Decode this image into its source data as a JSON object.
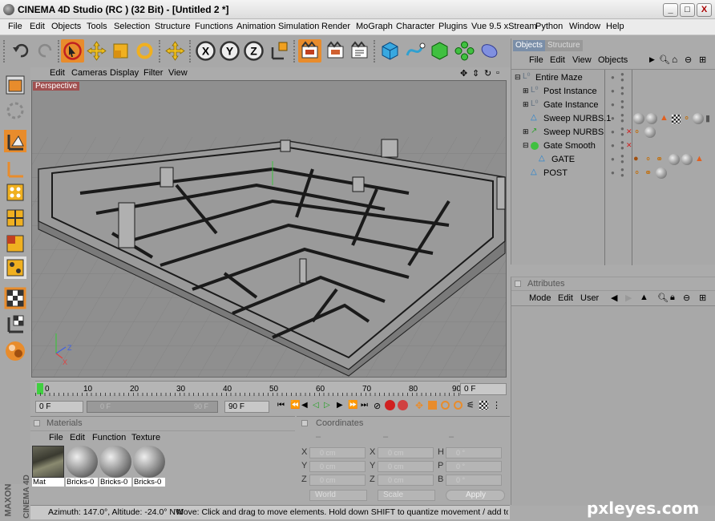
{
  "window": {
    "title": "CINEMA 4D Studio (RC ) (32 Bit) - [Untitled 2 *]",
    "minimize": "_",
    "maximize": "□",
    "close": "X"
  },
  "menubar": [
    "File",
    "Edit",
    "Objects",
    "Tools",
    "Selection",
    "Structure",
    "Functions",
    "Animation",
    "Simulation",
    "Render",
    "MoGraph",
    "Character",
    "Plugins",
    "Vue 9.5 xStream",
    "Python",
    "Window",
    "Help"
  ],
  "viewport": {
    "menu": [
      "Edit",
      "Cameras",
      "Display",
      "Filter",
      "View"
    ],
    "label": "Perspective",
    "axis_z": "Z",
    "axis_x": "X"
  },
  "timeline": {
    "ruler": [
      "0",
      "10",
      "20",
      "30",
      "40",
      "50",
      "60",
      "70",
      "80",
      "90"
    ],
    "current_frame": "0 F",
    "start_frame": "0 F",
    "range_end": "90 F",
    "slider_end": "90 F",
    "end_frame": "90 F"
  },
  "materials": {
    "title": "Materials",
    "menu": [
      "File",
      "Edit",
      "Function",
      "Texture"
    ],
    "items": [
      {
        "label": "Mat"
      },
      {
        "label": "Bricks-0"
      },
      {
        "label": "Bricks-0"
      },
      {
        "label": "Bricks-0"
      }
    ]
  },
  "coordinates": {
    "title": "Coordinates",
    "col_headers": [
      "–",
      "–",
      "–"
    ],
    "rows": [
      {
        "l1": "X",
        "v1": "0 cm",
        "l2": "X",
        "v2": "0 cm",
        "l3": "H",
        "v3": "0 °"
      },
      {
        "l1": "Y",
        "v1": "0 cm",
        "l2": "Y",
        "v2": "0 cm",
        "l3": "P",
        "v3": "0 °"
      },
      {
        "l1": "Z",
        "v1": "0 cm",
        "l2": "Z",
        "v2": "0 cm",
        "l3": "B",
        "v3": "0 °"
      }
    ],
    "space": "World",
    "mode": "Scale",
    "apply": "Apply"
  },
  "objects": {
    "tabs": [
      "Objects",
      "Structure"
    ],
    "menu": [
      "File",
      "Edit",
      "View",
      "Objects"
    ],
    "items": [
      {
        "name": "Entire Maze",
        "kind": "null"
      },
      {
        "name": "Post Instance",
        "kind": "null"
      },
      {
        "name": "Gate Instance",
        "kind": "null"
      },
      {
        "name": "Sweep NURBS.1",
        "kind": "spline"
      },
      {
        "name": "Sweep NURBS",
        "kind": "sweep"
      },
      {
        "name": "Gate Smooth",
        "kind": "smooth"
      },
      {
        "name": "GATE",
        "kind": "poly"
      },
      {
        "name": "POST",
        "kind": "poly"
      }
    ]
  },
  "attributes": {
    "title": "Attributes",
    "menu": [
      "Mode",
      "Edit",
      "User"
    ]
  },
  "status": {
    "left": "Azimuth: 147.0°, Altitude: -24.0°  NW",
    "right": "Move: Click and drag to move elements. Hold down SHIFT to quantize movement / add to the selec"
  },
  "branding": {
    "maxon": "MAXON",
    "cinema": "CINEMA 4D",
    "watermark": "pxleyes.com"
  },
  "colors": {
    "ui_gray": "#ababab",
    "viewport_gray": "#8f8f8f",
    "active_orange": "#e88c2c",
    "tab_active": "#7a8ea8"
  }
}
